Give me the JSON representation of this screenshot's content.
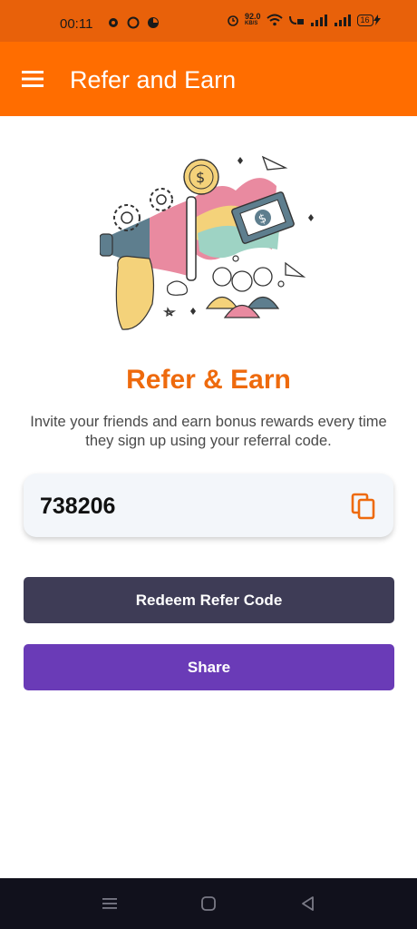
{
  "status_bar": {
    "time": "00:11",
    "network_speed_value": "92.0",
    "network_speed_unit": "KB/S",
    "battery": "16"
  },
  "app_bar": {
    "title": "Refer and Earn",
    "menu_icon": "hamburger-menu-icon"
  },
  "illustration": {
    "description_icon": "megaphone-referral-illustration"
  },
  "referral": {
    "heading": "Refer & Earn",
    "subtitle": "Invite your friends and earn bonus rewards every time they sign up using your referral code.",
    "code": "738206",
    "copy_icon": "copy-icon"
  },
  "actions": {
    "redeem_label": "Redeem Refer Code",
    "share_label": "Share"
  },
  "colors": {
    "status_bar": "#E8610A",
    "app_bar": "#FF6D00",
    "heading": "#EE6A0D",
    "redeem_button": "#3E3C56",
    "share_button": "#6A3BB7",
    "nav_bar": "#11111C"
  },
  "nav": {
    "recents_icon": "recents-icon",
    "home_icon": "home-icon",
    "back_icon": "back-icon"
  }
}
